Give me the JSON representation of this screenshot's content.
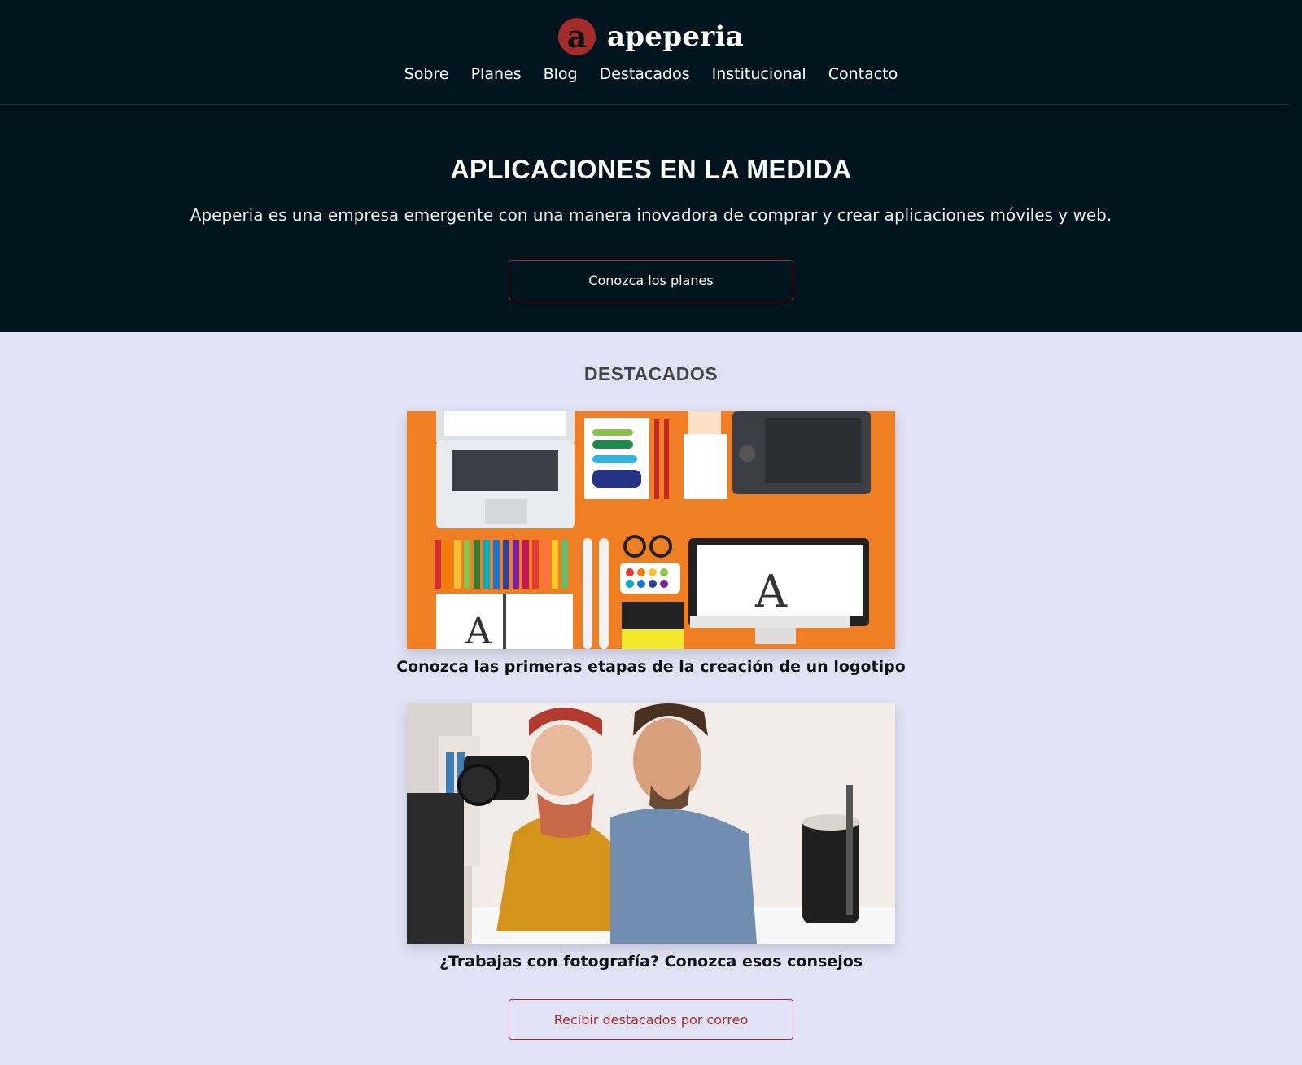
{
  "brand": {
    "logo_letter": "a",
    "name": "apeperia"
  },
  "nav": {
    "items": [
      "Sobre",
      "Planes",
      "Blog",
      "Destacados",
      "Institucional",
      "Contacto"
    ]
  },
  "hero": {
    "title": "APLICACIONES EN LA MEDIDA",
    "subtitle": "Apeperia es una empresa emergente con una manera inovadora de comprar y crear aplicaciones móviles y web.",
    "cta_label": "Conozca los planes"
  },
  "featured": {
    "title": "DESTACADOS",
    "cards": [
      {
        "caption": "Conozca las primeras etapas de la creación de un logotipo"
      },
      {
        "caption": "¿Trabajas con fotografía? Conozca esos consejos"
      }
    ],
    "email_button_label": "Recibir destacados por correo"
  },
  "colors": {
    "header_bg": "#00141e",
    "accent": "#a52a2a",
    "page_bg": "#e0e2f6",
    "card1_bg": "#ef7f22"
  }
}
